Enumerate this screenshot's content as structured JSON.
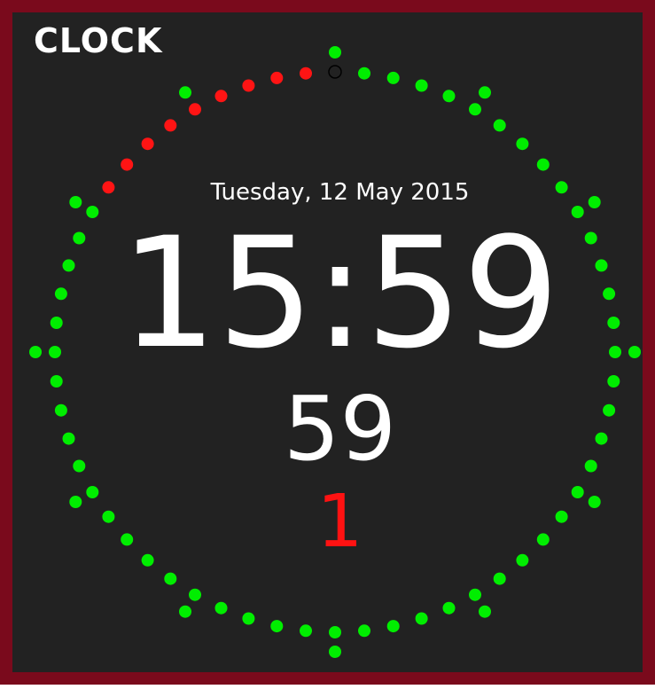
{
  "title": "CLOCK",
  "date": "Tuesday, 12 May 2015",
  "time": "15:59",
  "seconds": "59",
  "indicator": "1",
  "colors": {
    "frame": "#7a0a1c",
    "background": "#222222",
    "text": "#ffffff",
    "dot_on": "#00ee00",
    "dot_red": "#ff1414",
    "indicator": "#ff1212"
  },
  "ring": {
    "total_dots": 60,
    "red_dots": 9,
    "off_dots": 1,
    "hour_markers": 12
  }
}
